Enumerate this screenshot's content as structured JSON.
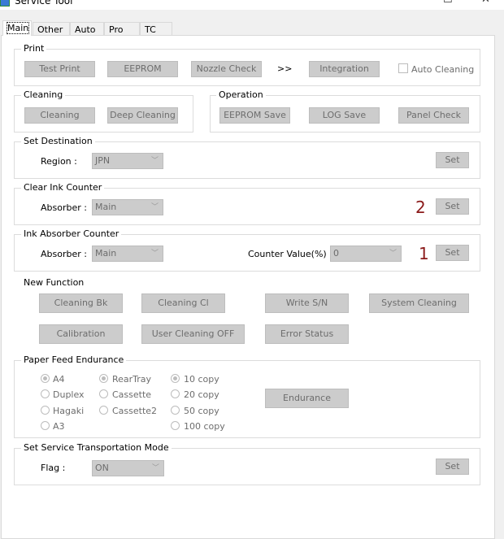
{
  "window": {
    "title": "Service Tool",
    "minimize": "—",
    "maximize": "☐",
    "close": "✕"
  },
  "tabs": [
    {
      "label": "Main",
      "selected": true
    },
    {
      "label": "Other"
    },
    {
      "label": "Auto"
    },
    {
      "label": "Pro"
    },
    {
      "label": "TC"
    }
  ],
  "print": {
    "label": "Print",
    "test_print": "Test Print",
    "eeprom": "EEPROM",
    "nozzle_check": "Nozzle Check",
    "arrow": ">>",
    "integration": "Integration",
    "auto_cleaning": "Auto Cleaning",
    "auto_cleaning_checked": false
  },
  "cleaning": {
    "label": "Cleaning",
    "cleaning": "Cleaning",
    "deep_cleaning": "Deep Cleaning"
  },
  "operation": {
    "label": "Operation",
    "eeprom_save": "EEPROM Save",
    "log_save": "LOG Save",
    "panel_check": "Panel Check"
  },
  "set_destination": {
    "label": "Set Destination",
    "region_label": "Region :",
    "region_value": "JPN",
    "set": "Set"
  },
  "clear_ink_counter": {
    "label": "Clear Ink Counter",
    "absorber_label": "Absorber :",
    "absorber_value": "Main",
    "annotation": "2",
    "set": "Set"
  },
  "ink_absorber_counter": {
    "label": "Ink Absorber Counter",
    "absorber_label": "Absorber :",
    "absorber_value": "Main",
    "counter_label": "Counter Value(%) :",
    "counter_value": "0",
    "annotation": "1",
    "set": "Set"
  },
  "new_function": {
    "label": "New Function",
    "buttons": [
      "Cleaning Bk",
      "Cleaning Cl",
      "Write S/N",
      "System Cleaning",
      "Calibration",
      "User Cleaning OFF",
      "Error Status"
    ]
  },
  "paper_feed": {
    "label": "Paper Feed Endurance",
    "paper": [
      {
        "label": "A4",
        "checked": true
      },
      {
        "label": "Duplex"
      },
      {
        "label": "Hagaki"
      },
      {
        "label": "A3"
      }
    ],
    "source": [
      {
        "label": "RearTray",
        "checked": true
      },
      {
        "label": "Cassette"
      },
      {
        "label": "Cassette2"
      }
    ],
    "copies": [
      {
        "label": "10 copy",
        "checked": true
      },
      {
        "label": "20 copy"
      },
      {
        "label": "50 copy"
      },
      {
        "label": "100 copy"
      }
    ],
    "endurance": "Endurance"
  },
  "transport": {
    "label": "Set Service Transportation Mode",
    "flag_label": "Flag :",
    "flag_value": "ON",
    "set": "Set"
  }
}
